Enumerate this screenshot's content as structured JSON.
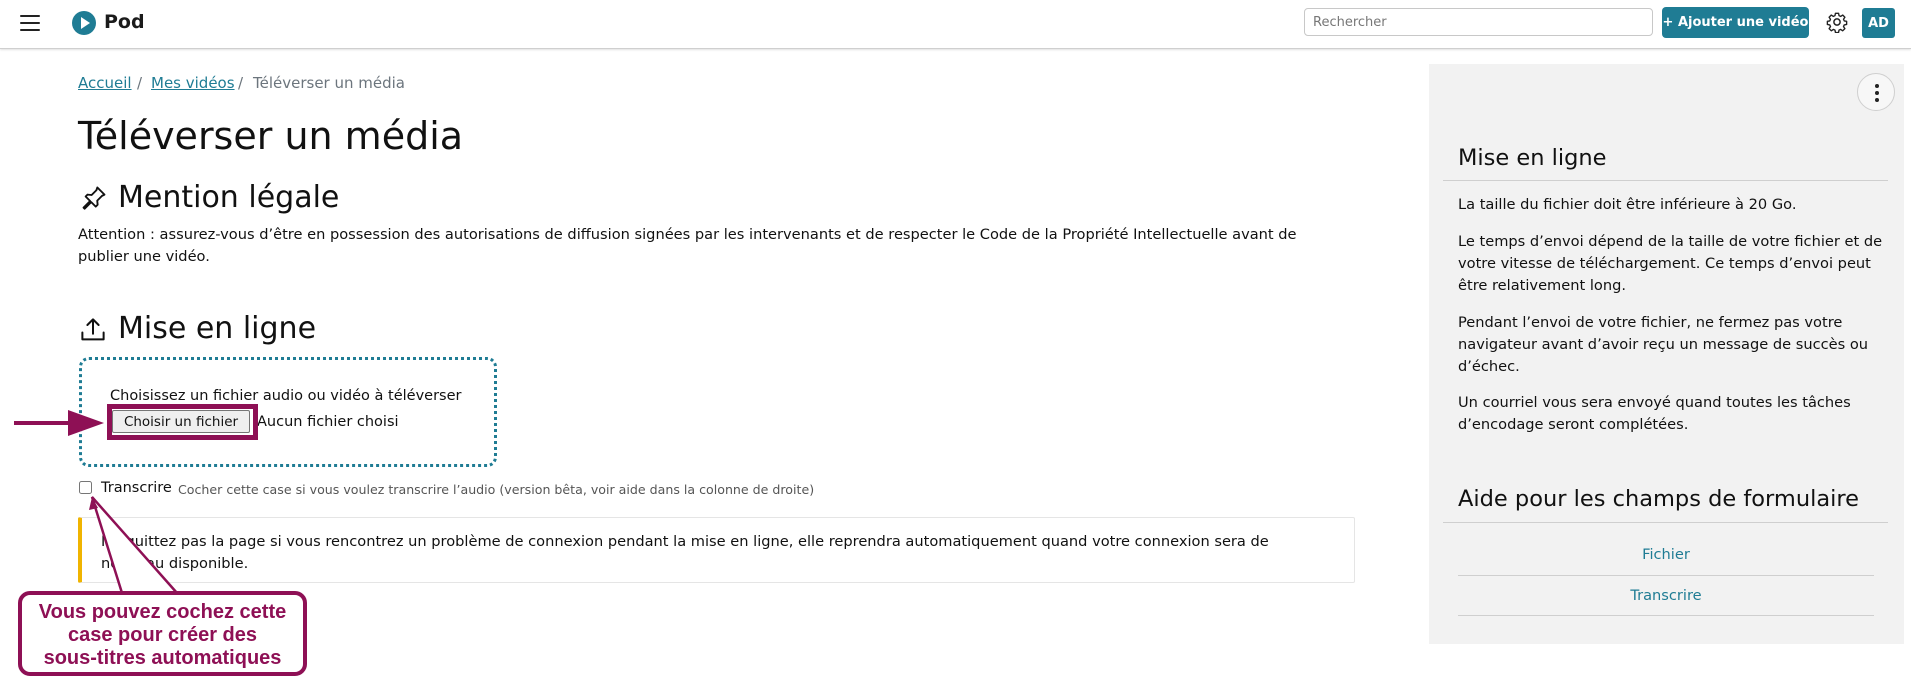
{
  "header": {
    "menu_icon": "hamburger-icon",
    "logo_icon": "play-circle-icon",
    "app_name": "Pod",
    "search_placeholder": "Rechercher",
    "add_video_label": "+ Ajouter une vidéo",
    "settings_icon": "gear-icon",
    "user_initials": "AD",
    "brand_color": "#1f7c94"
  },
  "breadcrumb": {
    "home": "Accueil",
    "my_videos": "Mes vidéos",
    "separator": "/",
    "current": "Téléverser un média"
  },
  "main": {
    "title": "Téléverser un média",
    "legal": {
      "icon": "pin-icon",
      "heading": "Mention légale",
      "text": "Attention : assurez-vous d’être en possession des autorisations de diffusion signées par les intervenants et de respecter le Code de la Propriété Intellectuelle avant de publier une vidéo."
    },
    "upload": {
      "icon": "upload-icon",
      "heading": "Mise en ligne",
      "file_label": "Choisissez un fichier audio ou vidéo à téléverser",
      "file_button": "Choisir un fichier",
      "no_file": "Aucun fichier choisi"
    },
    "transcribe": {
      "label": "Transcrire",
      "checked": false,
      "help": "Cocher cette case si vous voulez transcrire l’audio (version bêta, voir aide dans la colonne de droite)"
    },
    "alert": {
      "text": "Ne quittez pas la page si vous rencontrez un problème de connexion pendant la mise en ligne, elle reprendra automatiquement quand votre connexion sera de nouveau disponible.",
      "color": "#f0b400"
    }
  },
  "annotation": {
    "callout_lines": [
      "Vous pouvez cochez cette",
      "case pour créer des",
      "sous-titres automatiques"
    ],
    "color": "#8e1055"
  },
  "aside": {
    "menu_icon": "kebab-menu-icon",
    "upload_heading": "Mise en ligne",
    "paragraphs": [
      "La taille du fichier doit être inférieure à 20 Go.",
      "Le temps d’envoi dépend de la taille de votre fichier et de votre vitesse de téléchargement. Ce temps d’envoi peut être relativement long.",
      "Pendant l’envoi de votre fichier, ne fermez pas votre navigateur avant d’avoir reçu un message de succès ou d’échec.",
      "Un courriel vous sera envoyé quand toutes les tâches d’encodage seront complétées."
    ],
    "help_heading": "Aide pour les champs de formulaire",
    "help_links": [
      "Fichier",
      "Transcrire"
    ]
  }
}
